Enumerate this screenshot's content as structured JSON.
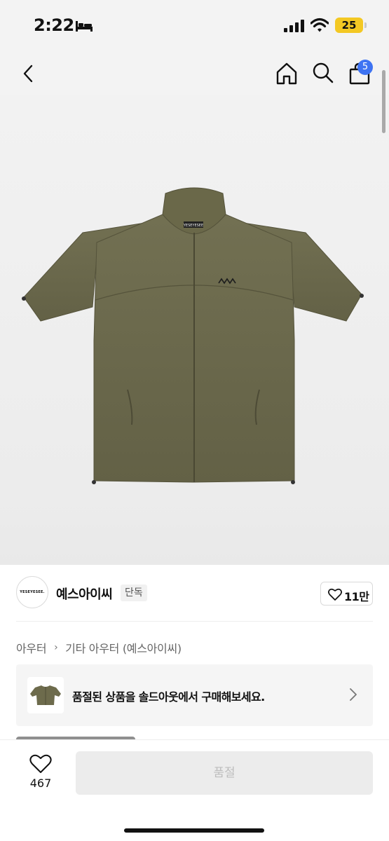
{
  "status_bar": {
    "time": "2:22",
    "battery": "25",
    "icons": [
      "bed-icon",
      "signal-icon",
      "wifi-icon",
      "battery-icon"
    ],
    "battery_color": "#f3c823"
  },
  "header": {
    "icons": [
      "back-chevron-icon",
      "home-icon",
      "search-icon",
      "shopping-bag-icon"
    ],
    "cart_badge": "5",
    "badge_color": "#3e73f2"
  },
  "product": {
    "image_icon": "olive-short-sleeve-zip-jacket",
    "jacket_color": "#6d6b4c",
    "label_text": "YESEYESEE"
  },
  "brand": {
    "logo_text": "YESEYESEE.",
    "name": "예스아이씨",
    "exclusive": "단독",
    "likes": "11만"
  },
  "breadcrumb": {
    "level1": "아우터",
    "level2": "기타 아우터 (예스아이씨)"
  },
  "soldout_banner": {
    "text": "품절된 상품을 솔드아웃에서 구매해보세요."
  },
  "bottom_bar": {
    "wish_count": "467",
    "action_label": "품절"
  }
}
